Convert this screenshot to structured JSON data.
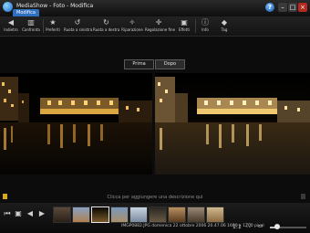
{
  "window": {
    "title": "MediaShow - Foto - Modifica",
    "mode_tab": "Modifica"
  },
  "toolbar": [
    {
      "label": "Indietro",
      "icon": "back-icon",
      "glyph": "◀"
    },
    {
      "label": "Confronta",
      "icon": "compare-icon",
      "glyph": "▥"
    },
    {
      "label": "Preferiti",
      "icon": "star-icon",
      "glyph": "★"
    },
    {
      "label": "Ruota a sinistra",
      "icon": "rotate-left-icon",
      "glyph": "↺"
    },
    {
      "label": "Ruota a destra",
      "icon": "rotate-right-icon",
      "glyph": "↻"
    },
    {
      "label": "Riparazione",
      "icon": "magic-wand-icon",
      "glyph": "✧"
    },
    {
      "label": "Regolazione fine",
      "icon": "fine-tune-icon",
      "glyph": "✛"
    },
    {
      "label": "Effetti",
      "icon": "effects-icon",
      "glyph": "▣"
    },
    {
      "label": "Info",
      "icon": "info-icon",
      "glyph": "ⓘ"
    },
    {
      "label": "Tag",
      "icon": "tag-icon",
      "glyph": "◆"
    }
  ],
  "compare": {
    "before_label": "Prima",
    "after_label": "Dopo",
    "selected": "Dopo"
  },
  "caption_prompt": "Clicca per aggiungere una descrizione qui",
  "filmstrip": {
    "thumb_count": 9,
    "selected_index": 2
  },
  "status": {
    "filename": "IMGP0882.JPG",
    "datetime": "domenica 22 ottobre 2006 20.47.06",
    "dimensions": "1600 x 1200 pixel"
  },
  "zoom": {
    "label": "1:1",
    "level": 0.2
  },
  "colors": {
    "accent": "#2f6fbf",
    "close": "#b7281f",
    "rating": "#d8a81c"
  }
}
